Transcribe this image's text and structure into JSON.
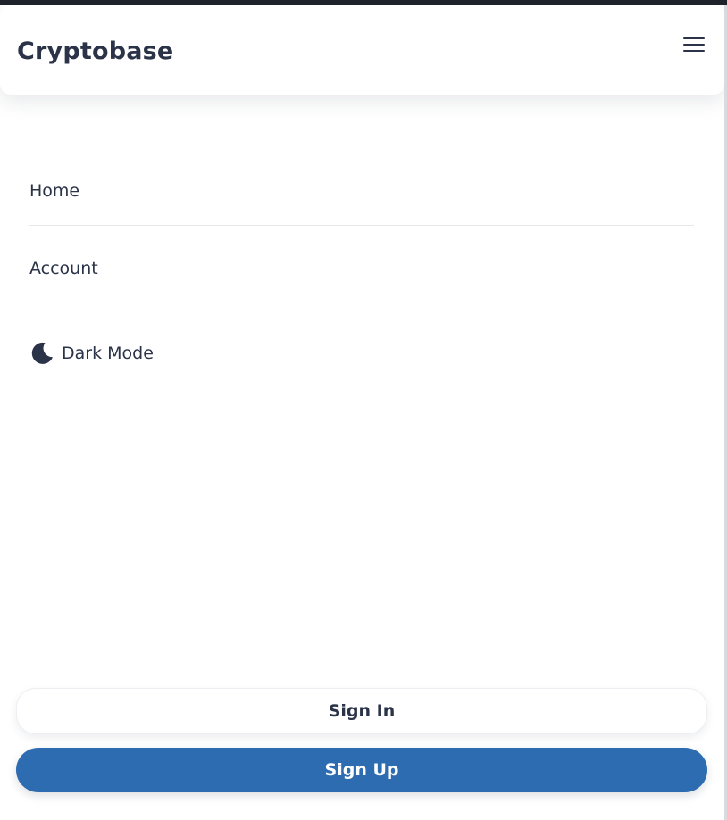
{
  "header": {
    "brand": "Cryptobase",
    "menu_icon": "hamburger-menu-icon"
  },
  "nav": {
    "items": [
      {
        "label": "Home"
      },
      {
        "label": "Account"
      }
    ],
    "dark_mode": {
      "label": "Dark Mode",
      "icon": "moon-icon"
    }
  },
  "actions": {
    "sign_in": "Sign In",
    "sign_up": "Sign Up"
  },
  "colors": {
    "text": "#2a3347",
    "primary": "#2d6cb0",
    "divider": "#e6e8ec"
  }
}
